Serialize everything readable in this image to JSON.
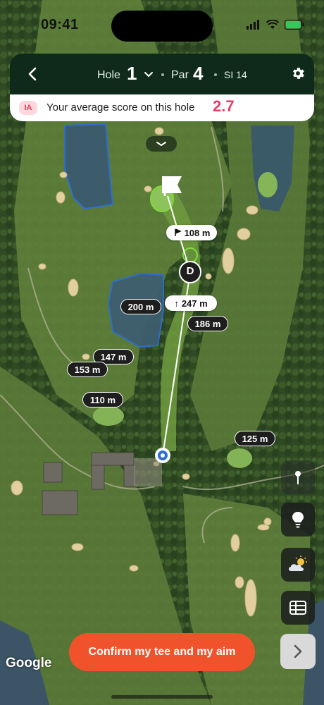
{
  "status": {
    "time": "09:41"
  },
  "header": {
    "hole_label": "Hole",
    "hole_number": "1",
    "par_label": "Par",
    "par_number": "4",
    "stroke_index": "SI 14"
  },
  "average": {
    "badge": "IA",
    "text": "Your average score on this hole",
    "value": "2.7"
  },
  "map": {
    "distances": {
      "to_green": "108 m",
      "tee_to_target": "247 m",
      "target_right": "186 m",
      "hazard_200": "200 m",
      "left_147": "147 m",
      "left_153": "153 m",
      "left_110": "110 m",
      "right_125": "125 m"
    },
    "target_marker": "D"
  },
  "actions": {
    "confirm": "Confirm my tee and my aim"
  },
  "attribution": "Google",
  "colors": {
    "accent": "#f0532b",
    "header_bg": "#0f2a1a",
    "score": "#e83a64",
    "green_line": "#7ddc3c"
  },
  "icons": [
    "back-icon",
    "chevron-down-icon",
    "gear-icon",
    "flag-icon",
    "pin-icon",
    "lightbulb-icon",
    "weather-icon",
    "scorecard-icon",
    "chevron-right-icon"
  ]
}
